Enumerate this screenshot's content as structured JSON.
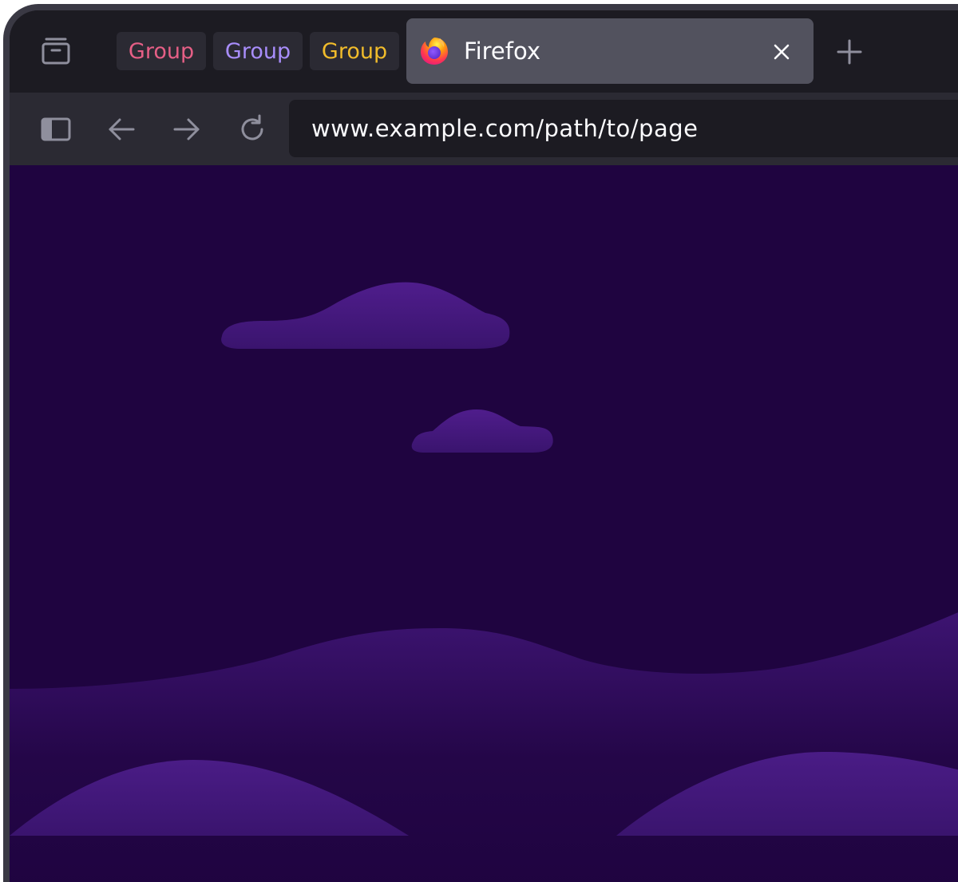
{
  "tab_groups": [
    {
      "label": "Group",
      "color": "#e65f86"
    },
    {
      "label": "Group",
      "color": "#a88dfb"
    },
    {
      "label": "Group",
      "color": "#f1bc2b"
    }
  ],
  "active_tab": {
    "title": "Firefox",
    "favicon": "firefox-logo-icon",
    "close_icon": "close-icon"
  },
  "toolbar": {
    "tab_manager_icon": "tab-manager-icon",
    "new_tab_icon": "plus-icon",
    "sidebar_icon": "sidebar-icon",
    "back_icon": "back-arrow-icon",
    "forward_icon": "forward-arrow-icon",
    "reload_icon": "reload-icon"
  },
  "urlbar": {
    "url": "www.example.com/path/to/page"
  },
  "colors": {
    "chrome_dark": "#1c1b22",
    "toolbar": "#2b2a33",
    "active_tab": "#52525e",
    "page_background": "#1f0440",
    "accent_purple": "#4f1d8c"
  }
}
